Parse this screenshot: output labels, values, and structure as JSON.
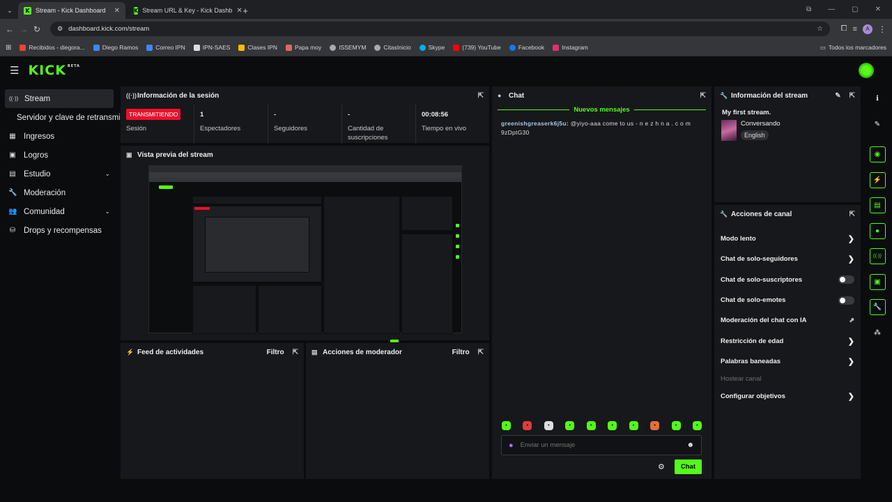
{
  "browser": {
    "tabs": [
      {
        "title": "Stream - Kick Dashboard",
        "active": true
      },
      {
        "title": "Stream URL & Key - Kick Dashb",
        "active": false
      }
    ],
    "url": "dashboard.kick.com/stream",
    "profile_initial": "A",
    "bookmarks": [
      {
        "label": "Recibidos - diegora...",
        "icon_color": "#ea4335"
      },
      {
        "label": "Diego Ramos",
        "icon_color": "#4285f4"
      },
      {
        "label": "Correo IPN",
        "icon_color": "#4285f4"
      },
      {
        "label": "IPN-SAES",
        "icon_color": "#dddddd"
      },
      {
        "label": "Clases IPN",
        "icon_color": "#fbbc04"
      },
      {
        "label": "Papa moy",
        "icon_color": "#e06666"
      },
      {
        "label": "ISSEMYM",
        "icon_color": "#aaaaaa"
      },
      {
        "label": "CitasInicio",
        "icon_color": "#aaaaaa"
      },
      {
        "label": "Skype",
        "icon_color": "#00aff0"
      },
      {
        "label": "(739) YouTube",
        "icon_color": "#ff0000"
      },
      {
        "label": "Facebook",
        "icon_color": "#1877f2"
      },
      {
        "label": "Instagram",
        "icon_color": "#e1306c"
      }
    ],
    "all_bookmarks": "Todos los marcadores"
  },
  "brand": {
    "logo": "KICK",
    "beta": "BETA",
    "accent": "#53fc18"
  },
  "sidebar": {
    "items": [
      {
        "label": "Stream",
        "icon": "broadcast-icon",
        "glyph": "((·))"
      },
      {
        "label": "Servidor y clave de retransmi",
        "sub": true
      },
      {
        "label": "Ingresos",
        "icon": "chart-icon",
        "glyph": "▦"
      },
      {
        "label": "Logros",
        "icon": "trophy-icon",
        "glyph": "▣"
      },
      {
        "label": "Estudio",
        "icon": "studio-icon",
        "glyph": "▤",
        "chevron": "⌄"
      },
      {
        "label": "Moderación",
        "icon": "wrench-icon",
        "glyph": "🔧"
      },
      {
        "label": "Comunidad",
        "icon": "people-icon",
        "glyph": "👥",
        "chevron": "⌄"
      },
      {
        "label": "Drops y recompensas",
        "icon": "drops-icon",
        "glyph": "⛁"
      }
    ]
  },
  "session": {
    "title": "Información de la sesión",
    "stats": [
      {
        "value": "TRANSMITIENDO",
        "label": "Sesión",
        "badge": true
      },
      {
        "value": "1",
        "label": "Espectadores"
      },
      {
        "value": "-",
        "label": "Seguidores"
      },
      {
        "value": "-",
        "label": "Cantidad de suscripciones"
      },
      {
        "value": "00:08:56",
        "label": "Tiempo en vivo"
      }
    ]
  },
  "preview": {
    "title": "Vista previa del stream"
  },
  "feed": {
    "title": "Feed de actividades",
    "filter": "Filtro"
  },
  "modactions": {
    "title": "Acciones de moderador",
    "filter": "Filtro"
  },
  "chat": {
    "title": "Chat",
    "new_messages": "Nuevos mensajes",
    "messages": [
      {
        "user": "greenishgreaserk6j5u:",
        "text": "@yiyo-aaa come to us - n e z h n a . c o m 9zDptG30"
      }
    ],
    "placeholder": "Enviar un mensaje",
    "send": "Chat"
  },
  "stream_info": {
    "title": "Información del stream",
    "stream_title": "My first stream.",
    "category": "Conversando",
    "language": "English"
  },
  "channel_actions": {
    "title": "Acciones de canal",
    "items": [
      {
        "label": "Modo lento",
        "control": "arrow"
      },
      {
        "label": "Chat de solo-seguidores",
        "control": "arrow"
      },
      {
        "label": "Chat de solo-suscriptores",
        "control": "toggle",
        "on": false
      },
      {
        "label": "Chat de solo-emotes",
        "control": "toggle",
        "on": false
      },
      {
        "label": "Moderación del chat con IA",
        "control": "external"
      },
      {
        "label": "Restricción de edad",
        "control": "arrow"
      },
      {
        "label": "Palabras baneadas",
        "control": "arrow"
      },
      {
        "label": "Hostear canal",
        "control": "disabled"
      },
      {
        "label": "Configurar objetivos",
        "control": "arrow"
      }
    ]
  }
}
